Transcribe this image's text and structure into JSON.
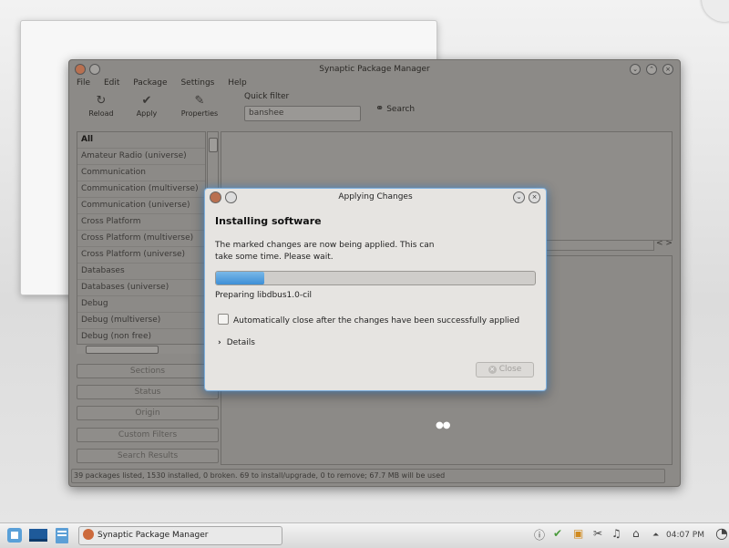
{
  "main_window": {
    "title": "Synaptic Package Manager",
    "menu": [
      "File",
      "Edit",
      "Package",
      "Settings",
      "Help"
    ],
    "toolbar": {
      "reload": "Reload",
      "apply": "Apply",
      "properties": "Properties",
      "quick_filter_label": "Quick filter",
      "quick_filter_value": "banshee",
      "search": "Search"
    },
    "sections": [
      "All",
      "Amateur Radio (universe)",
      "Communication",
      "Communication (multiverse)",
      "Communication (universe)",
      "Cross Platform",
      "Cross Platform (multiverse)",
      "Cross Platform (universe)",
      "Databases",
      "Databases (universe)",
      "Debug",
      "Debug (multiverse)",
      "Debug (non free)",
      "Debug (universe)"
    ],
    "side_buttons": [
      "Sections",
      "Status",
      "Origin",
      "Custom Filters",
      "Search Results"
    ],
    "status_bar": "39 packages listed, 1530 installed, 0 broken. 69 to install/upgrade, 0 to remove; 67.7 MB will be used"
  },
  "dialog": {
    "title": "Applying Changes",
    "heading": "Installing software",
    "message": "The marked changes are now being applied. This can take some time. Please wait.",
    "progress": 0.15,
    "status": "Preparing libdbus1.0-cil",
    "auto_close_label": "Automatically close after the changes have been successfully applied",
    "auto_close_checked": false,
    "details_label": "Details",
    "close_label": "Close"
  },
  "taskbar": {
    "task_label": "Synaptic Package Manager",
    "clock": "04:07 PM"
  },
  "colors": {
    "accent": "#3d8fd6",
    "dialog_glow": "#7fb0dd"
  }
}
